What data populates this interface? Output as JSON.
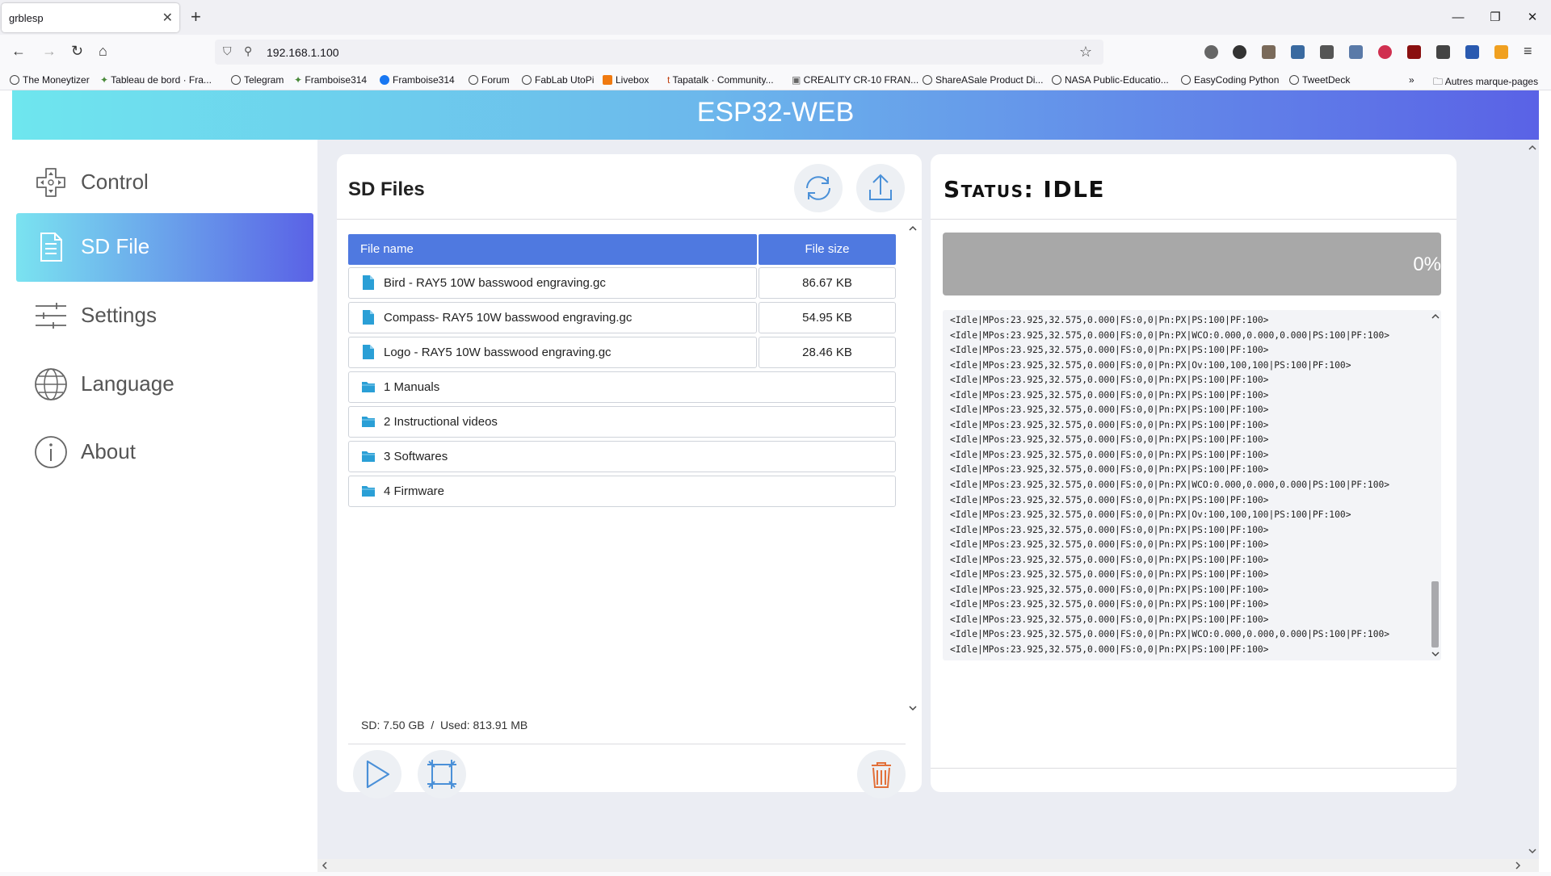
{
  "browser": {
    "tab_title": "grblesp",
    "url": "192.168.1.100",
    "bookmarks": [
      "The Moneytizer",
      "Tableau de bord · Fra...",
      "Telegram",
      "Framboise314",
      "Framboise314",
      "Forum",
      "FabLab UtoPi",
      "Livebox",
      "Tapatalk · Community...",
      "CREALITY CR-10 FRAN...",
      "ShareASale Product Di...",
      "NASA Public-Educatio...",
      "EasyCoding Python",
      "TweetDeck"
    ],
    "other_bookmarks": "Autres marque-pages"
  },
  "app": {
    "title": "ESP32-WEB"
  },
  "sidebar": {
    "items": [
      {
        "label": "Control",
        "icon": "gamepad-icon",
        "active": false
      },
      {
        "label": "SD File",
        "icon": "document-icon",
        "active": true
      },
      {
        "label": "Settings",
        "icon": "sliders-icon",
        "active": false
      },
      {
        "label": "Language",
        "icon": "globe-icon",
        "active": false
      },
      {
        "label": "About",
        "icon": "info-icon",
        "active": false
      }
    ]
  },
  "sd": {
    "title": "SD Files",
    "columns": {
      "name": "File name",
      "size": "File size"
    },
    "files": [
      {
        "name": "Bird - RAY5 10W basswood engraving.gc",
        "size": "86.67 KB",
        "type": "file"
      },
      {
        "name": "Compass- RAY5 10W basswood engraving.gc",
        "size": "54.95 KB",
        "type": "file"
      },
      {
        "name": "Logo - RAY5 10W basswood engraving.gc",
        "size": "28.46 KB",
        "type": "file"
      },
      {
        "name": "1 Manuals",
        "type": "folder"
      },
      {
        "name": "2 Instructional videos",
        "type": "folder"
      },
      {
        "name": "3 Softwares",
        "type": "folder"
      },
      {
        "name": "4 Firmware",
        "type": "folder"
      }
    ],
    "info": "SD: 7.50 GB  /  Used: 813.91 MB"
  },
  "status": {
    "title": "Status: IDLE",
    "progress": 0,
    "progress_label": "0%",
    "console": [
      "<Idle|MPos:23.925,32.575,0.000|FS:0,0|Pn:PX|PS:100|PF:100>",
      "<Idle|MPos:23.925,32.575,0.000|FS:0,0|Pn:PX|WCO:0.000,0.000,0.000|PS:100|PF:100>",
      "<Idle|MPos:23.925,32.575,0.000|FS:0,0|Pn:PX|PS:100|PF:100>",
      "<Idle|MPos:23.925,32.575,0.000|FS:0,0|Pn:PX|Ov:100,100,100|PS:100|PF:100>",
      "<Idle|MPos:23.925,32.575,0.000|FS:0,0|Pn:PX|PS:100|PF:100>",
      "<Idle|MPos:23.925,32.575,0.000|FS:0,0|Pn:PX|PS:100|PF:100>",
      "<Idle|MPos:23.925,32.575,0.000|FS:0,0|Pn:PX|PS:100|PF:100>",
      "<Idle|MPos:23.925,32.575,0.000|FS:0,0|Pn:PX|PS:100|PF:100>",
      "<Idle|MPos:23.925,32.575,0.000|FS:0,0|Pn:PX|PS:100|PF:100>",
      "<Idle|MPos:23.925,32.575,0.000|FS:0,0|Pn:PX|PS:100|PF:100>",
      "<Idle|MPos:23.925,32.575,0.000|FS:0,0|Pn:PX|PS:100|PF:100>",
      "<Idle|MPos:23.925,32.575,0.000|FS:0,0|Pn:PX|WCO:0.000,0.000,0.000|PS:100|PF:100>",
      "<Idle|MPos:23.925,32.575,0.000|FS:0,0|Pn:PX|PS:100|PF:100>",
      "<Idle|MPos:23.925,32.575,0.000|FS:0,0|Pn:PX|Ov:100,100,100|PS:100|PF:100>",
      "<Idle|MPos:23.925,32.575,0.000|FS:0,0|Pn:PX|PS:100|PF:100>",
      "<Idle|MPos:23.925,32.575,0.000|FS:0,0|Pn:PX|PS:100|PF:100>",
      "<Idle|MPos:23.925,32.575,0.000|FS:0,0|Pn:PX|PS:100|PF:100>",
      "<Idle|MPos:23.925,32.575,0.000|FS:0,0|Pn:PX|PS:100|PF:100>",
      "<Idle|MPos:23.925,32.575,0.000|FS:0,0|Pn:PX|PS:100|PF:100>",
      "<Idle|MPos:23.925,32.575,0.000|FS:0,0|Pn:PX|PS:100|PF:100>",
      "<Idle|MPos:23.925,32.575,0.000|FS:0,0|Pn:PX|PS:100|PF:100>",
      "<Idle|MPos:23.925,32.575,0.000|FS:0,0|Pn:PX|WCO:0.000,0.000,0.000|PS:100|PF:100>",
      "<Idle|MPos:23.925,32.575,0.000|FS:0,0|Pn:PX|PS:100|PF:100>"
    ]
  },
  "colors": {
    "accent": "#4f79e0",
    "header_start": "#6ee6ee",
    "header_end": "#5a62e6",
    "delete": "#e2703a"
  }
}
